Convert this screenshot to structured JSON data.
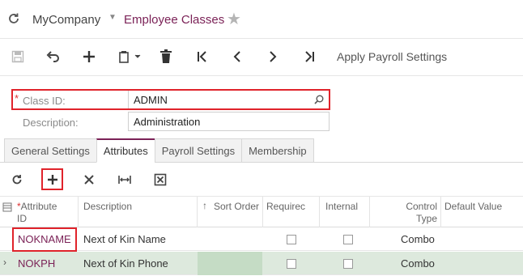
{
  "header": {
    "company": "MyCompany",
    "screen_title": "Employee Classes"
  },
  "toolbar": {
    "action_label": "Apply Payroll Settings"
  },
  "form": {
    "class_id_label": "Class ID:",
    "class_id_value": "ADMIN",
    "description_label": "Description:",
    "description_value": "Administration"
  },
  "tabs": [
    {
      "label": "General Settings"
    },
    {
      "label": "Attributes"
    },
    {
      "label": "Payroll Settings"
    },
    {
      "label": "Membership"
    }
  ],
  "grid": {
    "columns": {
      "attribute_id": "Attribute\nID",
      "description": "Description",
      "sort_order": "Sort Order",
      "required": "Requirec",
      "internal": "Internal",
      "control_type": "Control\nType",
      "default_value": "Default Value"
    },
    "rows": [
      {
        "attribute_id": "NOKNAME",
        "description": "Next of Kin Name",
        "control_type": "Combo"
      },
      {
        "attribute_id": "NOKPH",
        "description": "Next of Kin Phone",
        "control_type": "Combo"
      }
    ]
  },
  "colors": {
    "accent": "#7b2257",
    "highlight": "#e0232b",
    "selected_row": "#dde9dd"
  }
}
